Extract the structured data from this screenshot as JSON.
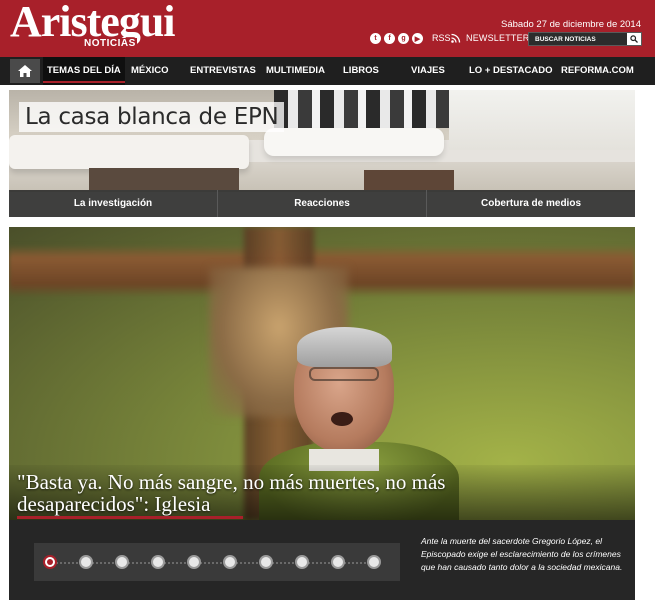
{
  "header": {
    "logo_main": "Aristegui",
    "logo_sub": "NOTICIAS",
    "date": "Sábado 27 de diciembre de 2014",
    "social_icons": [
      "twitter-icon",
      "facebook-icon",
      "googleplus-icon",
      "youtube-icon"
    ],
    "rss_label": "RSS",
    "newsletter_label": "NEWSLETTER",
    "search_placeholder": "BUSCAR NOTICIAS",
    "brand_color": "#a8202a"
  },
  "nav": {
    "home_icon": "home-icon",
    "items": [
      "TEMAS DEL DÍA",
      "MÉXICO",
      "ENTREVISTAS",
      "MULTIMEDIA",
      "LIBROS",
      "VIAJES",
      "LO + DESTACADO",
      "REFORMA.COM"
    ],
    "active_index": 0
  },
  "feature": {
    "title": "La casa blanca de EPN",
    "tabs": [
      "La investigación",
      "Reacciones",
      "Cobertura de medios"
    ]
  },
  "main_story": {
    "headline": "\"Basta ya. No más sangre, no más muertes, no más desaparecidos\": Iglesia",
    "summary": "Ante la muerte del sacerdote Gregorio López, el Episcopado exige el esclarecimiento de los crímenes que han causado tanto dolor a la sociedad mexicana.",
    "slide_count": 10,
    "active_slide": 0
  }
}
